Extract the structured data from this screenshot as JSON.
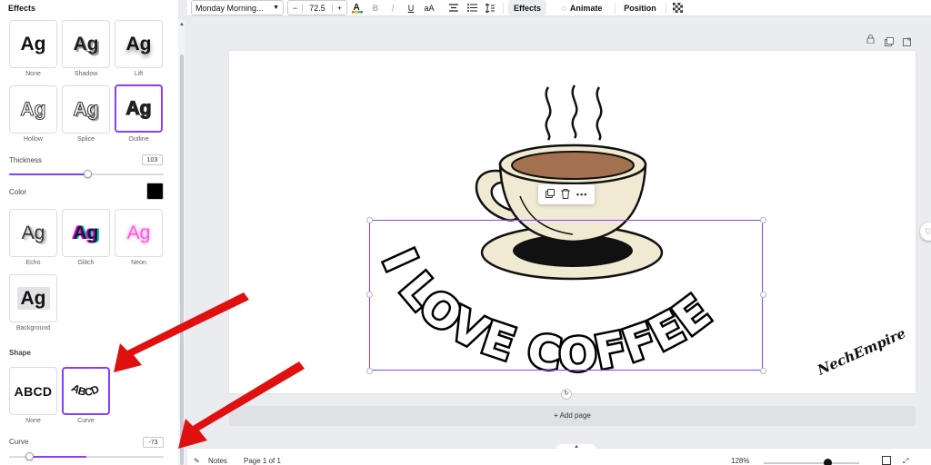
{
  "panel": {
    "title": "Effects",
    "styles": [
      {
        "label": "None"
      },
      {
        "label": "Shadow"
      },
      {
        "label": "Lift"
      },
      {
        "label": "Hollow"
      },
      {
        "label": "Splice"
      },
      {
        "label": "Outline",
        "selected": true
      },
      {
        "label": "Echo"
      },
      {
        "label": "Glitch"
      },
      {
        "label": "Neon"
      },
      {
        "label": "Background"
      }
    ],
    "preview_text": "Ag",
    "thickness": {
      "label": "Thickness",
      "value": "103",
      "level": 0.51
    },
    "color": {
      "label": "Color",
      "value": "#000000"
    },
    "shape": {
      "heading": "Shape",
      "preview_text": "ABCD",
      "options": [
        {
          "label": "None"
        },
        {
          "label": "Curve",
          "selected": true
        }
      ]
    },
    "curve": {
      "label": "Curve",
      "value": "-73",
      "level": 0.13
    }
  },
  "toolbar": {
    "font_name": "Monday Morning...",
    "font_size": "72.5",
    "minus": "−",
    "plus": "+",
    "effects": "Effects",
    "animate": "Animate",
    "position": "Position"
  },
  "canvas": {
    "headline": "I LOVE COFFEE",
    "signature": "NechEmpire",
    "add_page": "+ Add page"
  },
  "bottom": {
    "notes": "Notes",
    "page_info": "Page 1 of 1",
    "zoom": "128%",
    "zoom_level": 0.67
  },
  "colors": {
    "accent": "#8b3dff",
    "annotation": "#e01010",
    "cup": "#f1ead3",
    "coffee": "#a47150"
  },
  "icons": [
    "chevron-down-icon",
    "text-color-icon",
    "bold-icon",
    "italic-icon",
    "underline-icon",
    "case-icon",
    "align-icon",
    "list-icon",
    "spacing-icon",
    "animate-icon",
    "transparency-icon",
    "lock-icon",
    "copy-icon",
    "add-icon",
    "trash-icon",
    "more-icon",
    "rotate-icon",
    "notes-icon",
    "fullscreen-icon"
  ]
}
